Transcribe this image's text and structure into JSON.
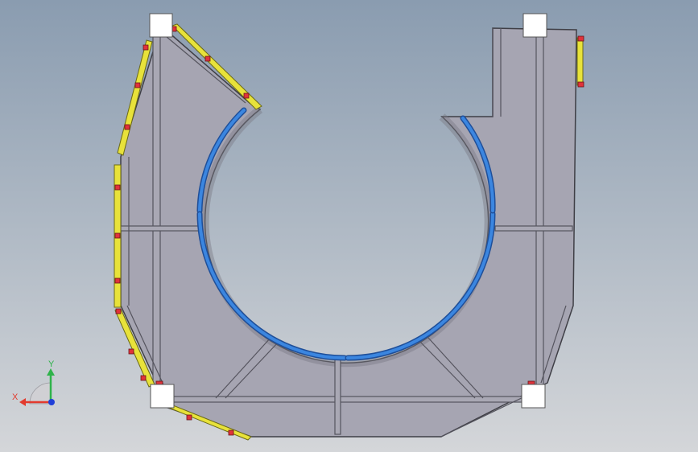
{
  "viewport": {
    "background_top": "#8a9cb0",
    "background_bottom": "#d4d6d9"
  },
  "model": {
    "plate_color": "#a6a5b2",
    "plate_stroke": "#3f3f46",
    "edge_color": "#6d6c78",
    "rail_color": "#3b86e0",
    "rail_dark": "#1f4f99",
    "guard_color": "#e8e23a",
    "guard_stroke": "#6b6a16",
    "clamp_color": "#e0323a",
    "corner_block_color": "#ffffff"
  },
  "triad": {
    "x_label": "X",
    "y_label": "Y",
    "x_color": "#e23a2e",
    "y_color": "#2fb34a",
    "z_color": "#1f3fd8"
  }
}
